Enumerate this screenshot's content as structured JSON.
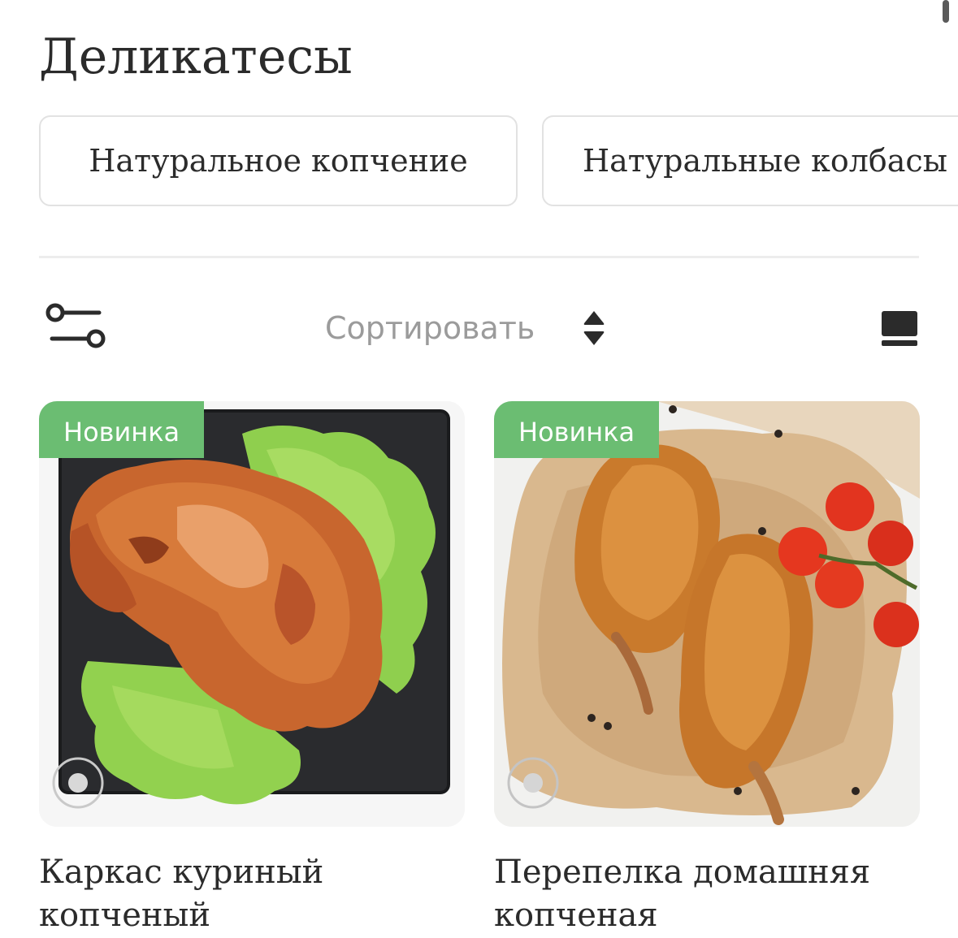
{
  "page": {
    "title": "Деликатесы"
  },
  "categories": [
    {
      "label": "Натуральное копчение"
    },
    {
      "label": "Натуральные колбасы"
    }
  ],
  "toolbar": {
    "sort_label": "Сортировать",
    "filter_icon": "filter-sliders-icon",
    "sort_icon": "sort-up-down-icon",
    "view_icon": "view-toggle-icon"
  },
  "products": [
    {
      "badge": "Новинка",
      "title": "Каркас куриный копченый",
      "image": "smoked-chicken-on-lettuce"
    },
    {
      "badge": "Новинка",
      "title": "Перепелка домашняя копченая",
      "image": "smoked-quail-with-tomatoes"
    }
  ],
  "colors": {
    "badge": "#6bbd72",
    "text": "#2b2b2b",
    "muted": "#9b9b9b",
    "chip_border": "#e2e2e2"
  }
}
